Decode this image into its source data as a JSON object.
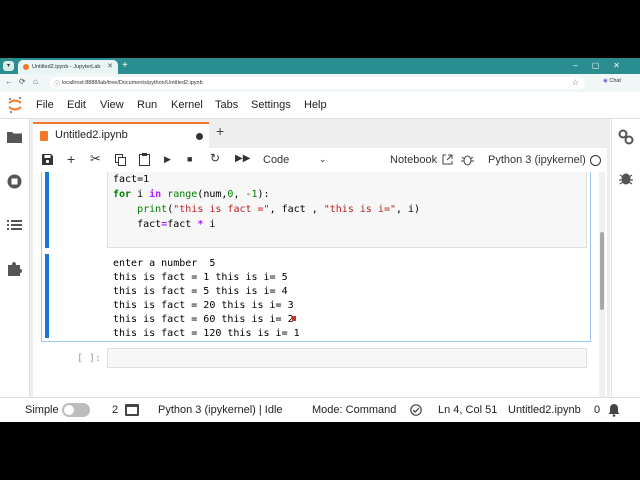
{
  "browser": {
    "tab_title": "Untitled2.ipynb - JupyterLab",
    "url": "localhost:8888/lab/tree/Documents/python/Untitled2.ipynb",
    "chat_label": "Chat"
  },
  "menubar": {
    "items": [
      "File",
      "Edit",
      "View",
      "Run",
      "Kernel",
      "Tabs",
      "Settings",
      "Help"
    ]
  },
  "document": {
    "tab_title": "Untitled2.ipynb"
  },
  "toolbar": {
    "cell_type": "Code",
    "notebook_label": "Notebook",
    "kernel_label": "Python 3 (ipykernel)"
  },
  "cell": {
    "code_line1": "fact=1",
    "code_for_kw": "for",
    "code_i": " i ",
    "code_in_kw": "in",
    "code_range": " range",
    "code_range_args_a": "(num,",
    "code_range_zero": "0",
    "code_range_args_b": ", ",
    "code_range_minus": "-1",
    "code_range_args_c": "):",
    "code_print": "print",
    "code_print_open": "(",
    "code_str1": "\"this is fact =\"",
    "code_print_mid": ", fact , ",
    "code_str2": "\"this is i=\"",
    "code_print_close": ", i)",
    "code_line4_a": "fact",
    "code_line4_eq": "=",
    "code_line4_b": "fact ",
    "code_line4_mul": "*",
    "code_line4_c": " i"
  },
  "output": {
    "lines": [
      "enter a number  5",
      "this is fact = 1 this is i= 5",
      "this is fact = 5 this is i= 4",
      "this is fact = 20 this is i= 3",
      "this is fact = 60 this is i= 2",
      "this is fact = 120 this is i= 1"
    ]
  },
  "empty_cell": {
    "prompt": "[ ]:"
  },
  "statusbar": {
    "mode_label": "Simple",
    "count": "2",
    "kernel_status": "Python 3 (ipykernel) | Idle",
    "mode": "Mode: Command",
    "cursor": "Ln 4, Col 51",
    "filename": "Untitled2.ipynb",
    "notifications": "0"
  },
  "colors": {
    "accent": "#f37726",
    "active_cell": "#1976d2",
    "browser_chrome": "#2a8d8f"
  }
}
